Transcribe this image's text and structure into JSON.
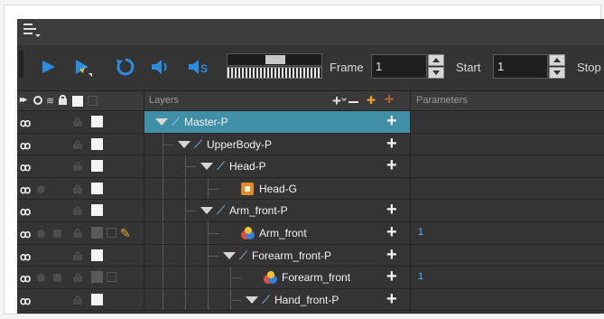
{
  "menu": {
    "icon": "hamburger-menu-icon"
  },
  "toolbar": {
    "buttons": [
      {
        "name": "play-icon",
        "color": "#2a8de0"
      },
      {
        "name": "first-frame-icon",
        "color": "#2a8de0"
      },
      {
        "name": "loop-icon",
        "color": "#2a8de0"
      },
      {
        "name": "sound-icon",
        "color": "#2a8de0"
      },
      {
        "name": "sound-scrub-icon",
        "color": "#2a8de0"
      }
    ],
    "frame_label": "Frame",
    "frame_value": "1",
    "start_label": "Start",
    "start_value": "1",
    "stop_label": "Stop"
  },
  "header": {
    "layers_label": "Layers",
    "parameters_label": "Parameters"
  },
  "layers": [
    {
      "name": "Master-P",
      "type": "peg",
      "selected": true,
      "param": ""
    },
    {
      "name": "UpperBody-P",
      "type": "peg",
      "selected": false,
      "param": ""
    },
    {
      "name": "Head-P",
      "type": "peg",
      "selected": false,
      "param": ""
    },
    {
      "name": "Head-G",
      "type": "drawing",
      "selected": false,
      "param": ""
    },
    {
      "name": "Arm_front-P",
      "type": "peg",
      "selected": false,
      "param": ""
    },
    {
      "name": "Arm_front",
      "type": "deformation",
      "selected": false,
      "param": "1"
    },
    {
      "name": "Forearm_front-P",
      "type": "peg",
      "selected": false,
      "param": ""
    },
    {
      "name": "Forearm_front",
      "type": "deformation",
      "selected": false,
      "param": "1"
    },
    {
      "name": "Hand_front-P",
      "type": "peg",
      "selected": false,
      "param": ""
    }
  ],
  "colors": {
    "accent_blue": "#2a8de0",
    "selection": "#3f8fa6",
    "panel": "#343434",
    "param_text": "#48b6ff"
  }
}
